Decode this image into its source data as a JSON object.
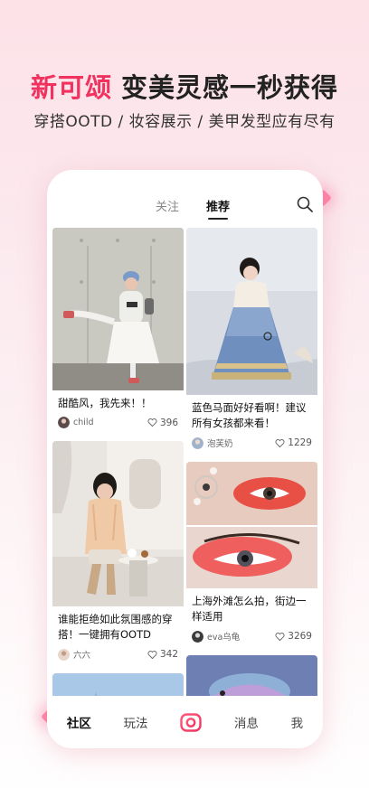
{
  "promo": {
    "brand": "新可颂",
    "headline": "变美灵感一秒获得",
    "subline": "穿搭OOTD / 妆容展示 / 美甲发型应有尽有"
  },
  "topnav": {
    "tabs": [
      "关注",
      "推荐"
    ],
    "active_tab": "推荐"
  },
  "feed": {
    "left": [
      {
        "title": "甜酷风，我先来！！",
        "user": "child",
        "likes": "396"
      },
      {
        "title": "谁能拒绝如此氛围感的穿搭！一键拥有OOTD",
        "user": "六六",
        "likes": "342"
      },
      {
        "title": "",
        "user": "",
        "likes": ""
      }
    ],
    "right": [
      {
        "title": "蓝色马面好好看啊！建议所有女孩都来看！",
        "user": "泡芙奶",
        "likes": "1229"
      },
      {
        "title": "上海外滩怎么拍，街边一样适用",
        "user": "eva乌龟",
        "likes": "3269"
      },
      {
        "title": "",
        "user": "",
        "likes": ""
      }
    ]
  },
  "tabbar": {
    "items": [
      "社区",
      "玩法",
      "消息",
      "我"
    ],
    "active": "社区",
    "camera_icon": "camera-icon"
  },
  "colors": {
    "brand": "#f1325f",
    "background_top": "#fde2e8"
  }
}
